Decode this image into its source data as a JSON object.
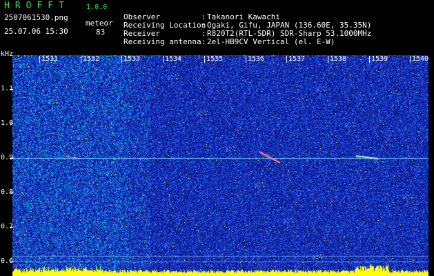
{
  "header": {
    "logo": "HROFFT",
    "version": "1.0.0",
    "filename": "2507061530.png",
    "datetime": "25.07.06 15:30",
    "mode": "meteor",
    "count": "83"
  },
  "info": [
    {
      "label": "Observer",
      "value": "Takanori Kawachi"
    },
    {
      "label": "Receiving Location",
      "value": "Ogaki, Gifu, JAPAN (136.60E, 35.35N)"
    },
    {
      "label": "Receiver",
      "value": "R820T2(RTL-SDR) SDR-Sharp 53.1000MHz"
    },
    {
      "label": "Receiving antenna",
      "value": "2el-HB9CV Vertical (el. E-W)"
    }
  ],
  "spectrogram": {
    "y_unit": "kHz",
    "y_ticks": [
      "1.1",
      "1.0",
      "0.9",
      "0.8",
      "0.7",
      "0.6"
    ],
    "y_values": [
      1.1,
      1.0,
      0.9,
      0.8,
      0.7,
      0.6
    ],
    "x_ticks": [
      "1531",
      "1532",
      "1533",
      "1534",
      "1535",
      "1536",
      "1537",
      "1538",
      "1539",
      "1540"
    ],
    "carrier_khz": 0.9,
    "colors": {
      "low": "#0c1a8a",
      "mid": "#2c6cff",
      "high": "#00e8e8",
      "peak": "#ffff00"
    }
  }
}
